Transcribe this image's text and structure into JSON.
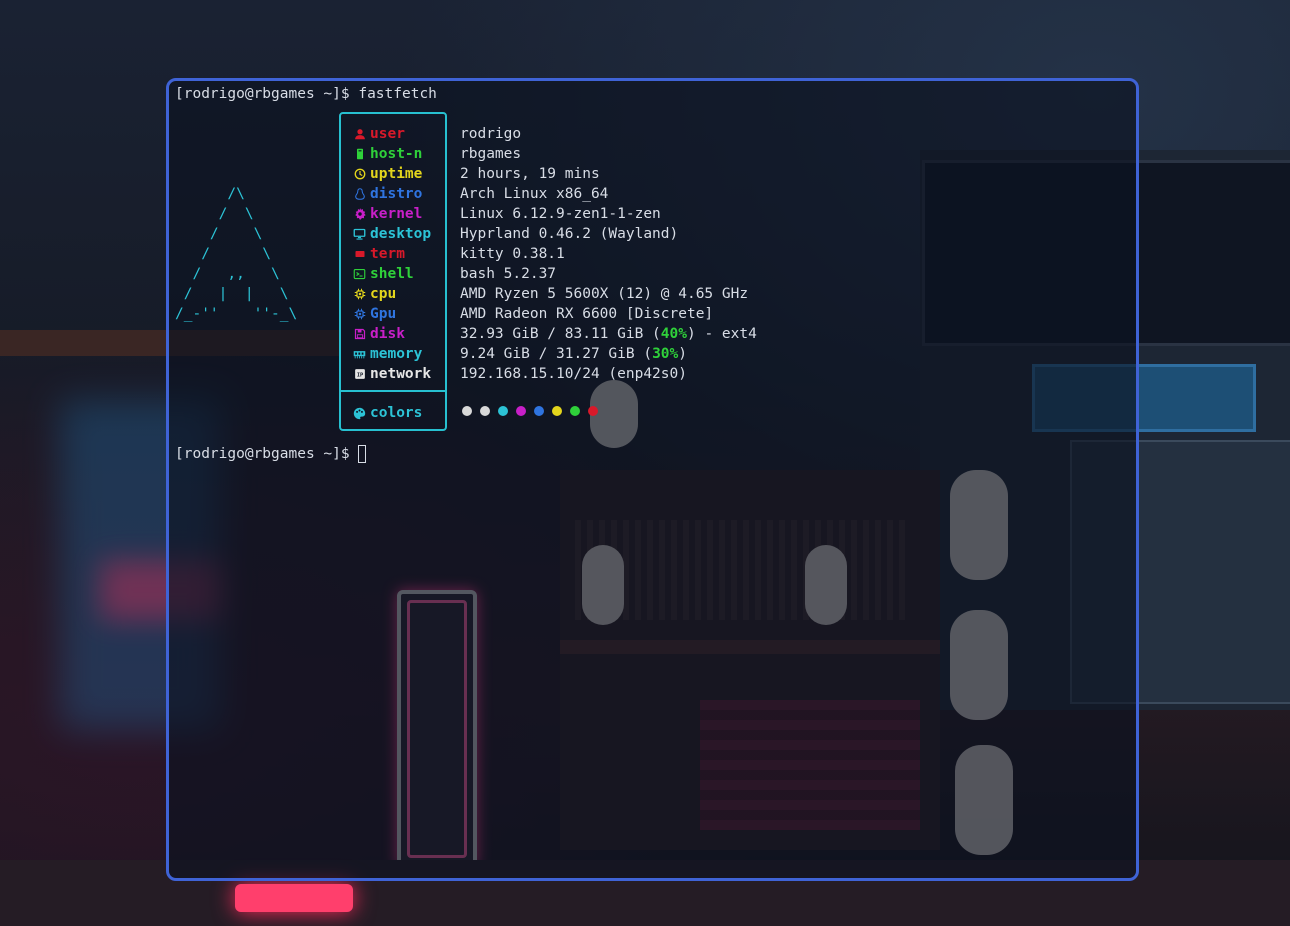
{
  "terminal": {
    "prompt_user_host": "[rodrigo@rbgames ~]$",
    "command": "fastfetch",
    "prompt2": "[rodrigo@rbgames ~]$",
    "ascii_logo": "      /\\\n     /  \\\n    /    \\\n   /      \\\n  /   ,,   \\\n /   |  |   \\\n/_-''    ''-_\\",
    "info": [
      {
        "key": "user",
        "icon": "user-icon",
        "color": "#d9192a",
        "value": "rodrigo"
      },
      {
        "key": "host-n",
        "icon": "device-icon",
        "color": "#2fd13a",
        "value": "rbgames"
      },
      {
        "key": "uptime",
        "icon": "clock-icon",
        "color": "#e3d51c",
        "value": "2 hours, 19 mins"
      },
      {
        "key": "distro",
        "icon": "linux-penguin-icon",
        "color": "#2f74e0",
        "value": "Arch Linux x86_64"
      },
      {
        "key": "kernel",
        "icon": "gear-icon",
        "color": "#c81fc8",
        "value": "Linux 6.12.9-zen1-1-zen"
      },
      {
        "key": "desktop",
        "icon": "monitor-icon",
        "color": "#2cc3d6",
        "value": "Hyprland 0.46.2 (Wayland)"
      },
      {
        "key": "term",
        "icon": "terminal-square-icon",
        "color": "#d9192a",
        "value": "kitty 0.38.1"
      },
      {
        "key": "shell",
        "icon": "shell-prompt-icon",
        "color": "#2fd13a",
        "value": "bash 5.2.37"
      },
      {
        "key": "cpu",
        "icon": "cpu-chip-icon",
        "color": "#e3d51c",
        "value": "AMD Ryzen 5 5600X (12) @ 4.65 GHz"
      },
      {
        "key": "Gpu",
        "icon": "gpu-chip-icon",
        "color": "#2f74e0",
        "value": "AMD Radeon RX 6600 [Discrete]"
      },
      {
        "key": "disk",
        "icon": "floppy-disk-icon",
        "color": "#c81fc8",
        "value_pre": "32.93 GiB / 83.11 GiB (",
        "value_pct": "40%",
        "value_post": ") - ext4"
      },
      {
        "key": "memory",
        "icon": "memory-stick-icon",
        "color": "#2cc3d6",
        "value_pre": "9.24 GiB / 31.27 GiB (",
        "value_pct": "30%",
        "value_post": ")"
      },
      {
        "key": "network",
        "icon": "network-ip-icon",
        "color": "#e6e6e6",
        "value": "192.168.15.10/24 (enp42s0)"
      }
    ],
    "colors_key": "colors",
    "colors_icon": "palette-icon",
    "colors_key_color": "#2cc3d6",
    "palette": [
      "#d9d9d9",
      "#d9d9d9",
      "#2cc3d6",
      "#c81fc8",
      "#2f74e0",
      "#e3d51c",
      "#2fd13a",
      "#d9192a"
    ],
    "pct_color": "#2fd13a",
    "border_color": "#3f63d6",
    "accent_box_color": "#27c0d0"
  }
}
